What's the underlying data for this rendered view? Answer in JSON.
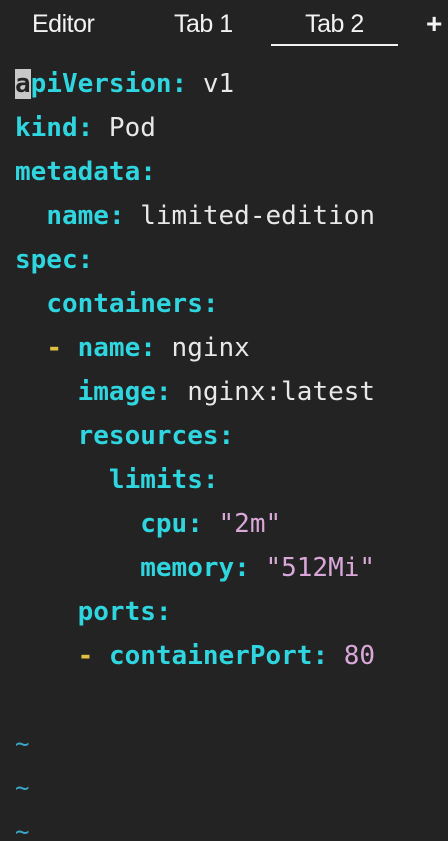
{
  "tabs": [
    {
      "label": "Editor",
      "active": false
    },
    {
      "label": "Tab 1",
      "active": false
    },
    {
      "label": "Tab 2",
      "active": true
    }
  ],
  "add_tab_label": "+",
  "code": {
    "line1": {
      "cursor_char": "a",
      "key_rest": "piVersion",
      "sep": ":",
      "value": " v1"
    },
    "line2": {
      "key": "kind",
      "sep": ":",
      "value": " Pod"
    },
    "line3": {
      "key": "metadata",
      "sep": ":"
    },
    "line4": {
      "indent": "  ",
      "key": "name",
      "sep": ":",
      "value": " limited-edition"
    },
    "line5": {
      "key": "spec",
      "sep": ":"
    },
    "line6": {
      "indent": "  ",
      "key": "containers",
      "sep": ":"
    },
    "line7": {
      "indent": "  ",
      "dash": "- ",
      "key": "name",
      "sep": ":",
      "value": " nginx"
    },
    "line8": {
      "indent": "    ",
      "key": "image",
      "sep": ":",
      "value": " nginx:latest"
    },
    "line9": {
      "indent": "    ",
      "key": "resources",
      "sep": ":"
    },
    "line10": {
      "indent": "      ",
      "key": "limits",
      "sep": ":"
    },
    "line11": {
      "indent": "        ",
      "key": "cpu",
      "sep": ":",
      "space": " ",
      "value": "\"2m\""
    },
    "line12": {
      "indent": "        ",
      "key": "memory",
      "sep": ":",
      "space": " ",
      "value": "\"512Mi\""
    },
    "line13": {
      "indent": "    ",
      "key": "ports",
      "sep": ":"
    },
    "line14": {
      "indent": "    ",
      "dash": "- ",
      "key": "containerPort",
      "sep": ":",
      "space": " ",
      "value": "80"
    }
  },
  "empty_line_marker": "~"
}
